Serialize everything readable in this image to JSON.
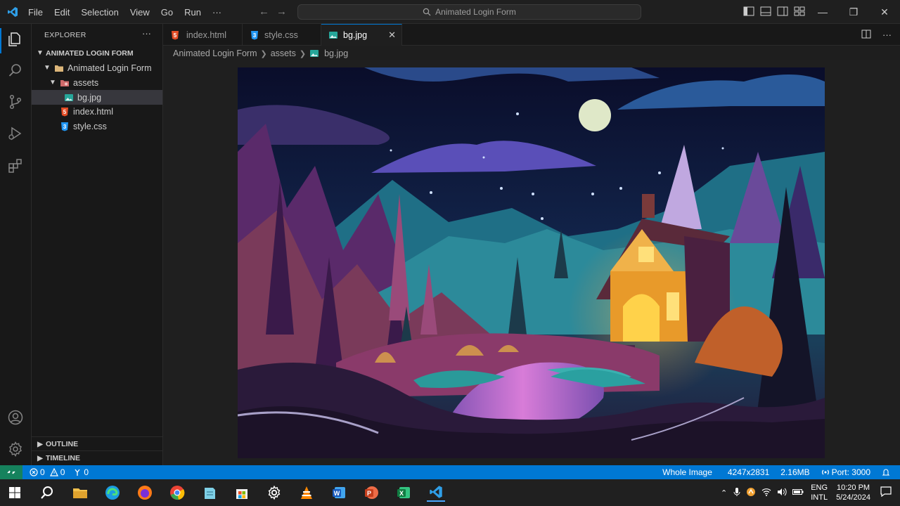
{
  "titlebar": {
    "menu": [
      "File",
      "Edit",
      "Selection",
      "View",
      "Go",
      "Run",
      "···"
    ],
    "search_text": "Animated Login Form"
  },
  "sidebar": {
    "header": "EXPLORER",
    "more": "···",
    "root": "ANIMATED LOGIN FORM",
    "tree": [
      {
        "label": "Animated Login Form",
        "type": "folder"
      },
      {
        "label": "assets",
        "type": "folder"
      },
      {
        "label": "bg.jpg",
        "type": "image"
      },
      {
        "label": "index.html",
        "type": "html"
      },
      {
        "label": "style.css",
        "type": "css"
      }
    ],
    "outline": "OUTLINE",
    "timeline": "TIMELINE"
  },
  "tabs": [
    {
      "label": "index.html",
      "icon": "html-file-icon"
    },
    {
      "label": "style.css",
      "icon": "css-file-icon"
    },
    {
      "label": "bg.jpg",
      "icon": "image-file-icon",
      "active": true
    }
  ],
  "breadcrumb": [
    "Animated Login Form",
    "assets",
    "bg.jpg"
  ],
  "statusbar": {
    "errors": "0",
    "warnings": "0",
    "ports": "0",
    "view_mode": "Whole Image",
    "dimensions": "4247x2831",
    "size": "2.16MB",
    "port": "Port: 3000"
  },
  "taskbar": {
    "lang_top": "ENG",
    "lang_bottom": "INTL",
    "time": "10:20 PM",
    "date": "5/24/2024"
  },
  "colors": {
    "accent": "#0078d4",
    "remote": "#16825d"
  }
}
